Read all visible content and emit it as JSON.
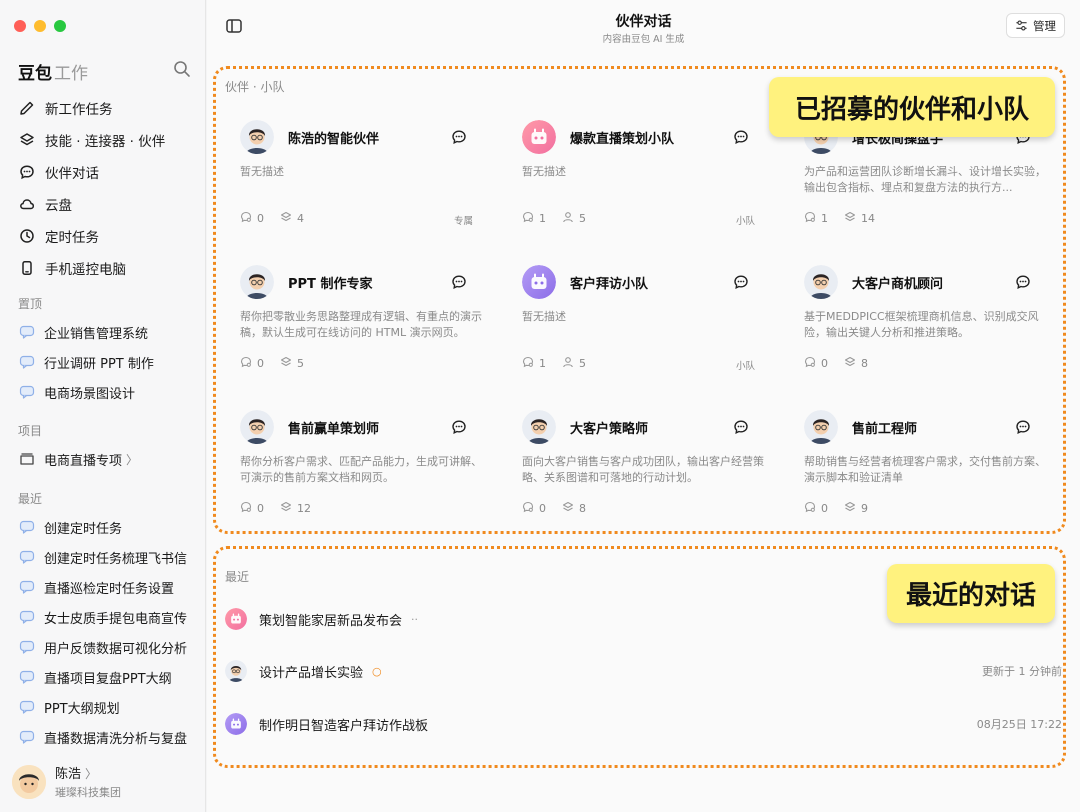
{
  "window": {
    "title": "伙伴对话",
    "subtitle": "内容由豆包 AI 生成",
    "manage_label": "管理"
  },
  "sidebar": {
    "brand": "豆包",
    "brand_sub": "工作",
    "menu": [
      {
        "label": "新工作任务",
        "icon": "edit-icon"
      },
      {
        "label": "技能 · 连接器 · 伙伴",
        "icon": "layers-icon"
      },
      {
        "label": "伙伴对话",
        "icon": "chat-icon"
      },
      {
        "label": "云盘",
        "icon": "cloud-icon"
      },
      {
        "label": "定时任务",
        "icon": "clock-icon"
      },
      {
        "label": "手机遥控电脑",
        "icon": "phone-icon"
      }
    ],
    "pinned_label": "置顶",
    "pinned": [
      {
        "label": "企业销售管理系统"
      },
      {
        "label": "行业调研 PPT 制作"
      },
      {
        "label": "电商场景图设计"
      }
    ],
    "projects_label": "项目",
    "projects": [
      {
        "label": "电商直播专项",
        "chevron": "〉"
      }
    ],
    "recent_label": "最近",
    "recent": [
      {
        "label": "创建定时任务"
      },
      {
        "label": "创建定时任务梳理飞书信"
      },
      {
        "label": "直播巡检定时任务设置"
      },
      {
        "label": "女士皮质手提包电商宣传"
      },
      {
        "label": "用户反馈数据可视化分析"
      },
      {
        "label": "直播项目复盘PPT大纲"
      },
      {
        "label": "PPT大纲规划"
      },
      {
        "label": "直播数据清洗分析与复盘"
      }
    ],
    "user": {
      "name": "陈浩",
      "chevron": "〉",
      "org": "璀璨科技集团"
    }
  },
  "partners": {
    "label": "伙伴 · 小队",
    "cards": [
      {
        "name": "陈浩的智能伙伴",
        "avatar": "person",
        "desc": "暂无描述",
        "uses": "0",
        "count": "4",
        "count_icon": "layers",
        "tag": "专属"
      },
      {
        "name": "爆款直播策划小队",
        "avatar": "robot-pink",
        "desc": "暂无描述",
        "uses": "1",
        "count": "5",
        "count_icon": "user",
        "tag": "小队"
      },
      {
        "name": "增长极简操盘手",
        "avatar": "person",
        "desc": "为产品和运营团队诊断增长漏斗、设计增长实验，输出包含指标、埋点和复盘方法的执行方...",
        "uses": "1",
        "count": "14",
        "count_icon": "layers",
        "tag": ""
      },
      {
        "name": "PPT 制作专家",
        "avatar": "person",
        "desc": "帮你把零散业务思路整理成有逻辑、有重点的演示稿，默认生成可在线访问的 HTML 演示网页。",
        "uses": "0",
        "count": "5",
        "count_icon": "layers",
        "tag": ""
      },
      {
        "name": "客户拜访小队",
        "avatar": "robot-purple",
        "desc": "暂无描述",
        "uses": "1",
        "count": "5",
        "count_icon": "user",
        "tag": "小队"
      },
      {
        "name": "大客户商机顾问",
        "avatar": "person",
        "desc": "基于MEDDPICC框架梳理商机信息、识别成交风险，输出关键人分析和推进策略。",
        "uses": "0",
        "count": "8",
        "count_icon": "layers",
        "tag": ""
      },
      {
        "name": "售前赢单策划师",
        "avatar": "person",
        "desc": "帮你分析客户需求、匹配产品能力，生成可讲解、可演示的售前方案文档和网页。",
        "uses": "0",
        "count": "12",
        "count_icon": "layers",
        "tag": ""
      },
      {
        "name": "大客户策略师",
        "avatar": "person",
        "desc": "面向大客户销售与客户成功团队，输出客户经营策略、关系图谱和可落地的行动计划。",
        "uses": "0",
        "count": "8",
        "count_icon": "layers",
        "tag": ""
      },
      {
        "name": "售前工程师",
        "avatar": "person",
        "desc": "帮助销售与经营者梳理客户需求，交付售前方案、演示脚本和验证清单",
        "uses": "0",
        "count": "9",
        "count_icon": "layers",
        "tag": ""
      }
    ]
  },
  "recent": {
    "label": "最近",
    "items": [
      {
        "title": "策划智能家居新品发布会",
        "suffix": "··",
        "time": "",
        "avatar": "robot-pink"
      },
      {
        "title": "设计产品增长实验",
        "suffix": "○",
        "time": "更新于 1 分钟前",
        "avatar": "person"
      },
      {
        "title": "制作明日智造客户拜访作战板",
        "suffix": "",
        "time": "08月25日 17:22",
        "avatar": "robot-purple"
      }
    ]
  },
  "callouts": {
    "partners": "已招募的伙伴和小队",
    "recent": "最近的对话"
  },
  "colors": {
    "accent_orange": "#f08a1e",
    "callout_yellow": "#fff27e",
    "traffic_red": "#ff5f57",
    "traffic_yellow": "#febc2e",
    "traffic_green": "#28c840"
  }
}
